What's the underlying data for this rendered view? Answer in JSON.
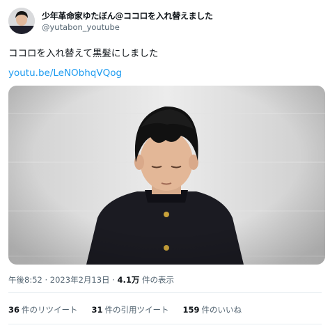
{
  "tweet": {
    "display_name": "少年革命家ゆたぼん@ココロを入れ替えました",
    "handle": "@yutabon_youtube",
    "text": "ココロを入れ替えて黒髪にしました",
    "link": "youtu.be/LeNObhqVQog",
    "avatar_icon": "profile-photo",
    "media_icon": "photo-boy-in-black-school-uniform"
  },
  "meta": {
    "time": "午後8:52",
    "sep1": " · ",
    "date": "2023年2月13日",
    "sep2": " · ",
    "views_value": "4.1万",
    "views_label": " 件の表示"
  },
  "stats": {
    "retweets_value": "36",
    "retweets_label": "件のリツイート",
    "quotes_value": "31",
    "quotes_label": "件の引用ツイート",
    "likes_value": "159",
    "likes_label": "件のいいね"
  },
  "colors": {
    "link": "#1d9bf0",
    "secondary_text": "#536471",
    "divider": "#e6ecf0"
  }
}
